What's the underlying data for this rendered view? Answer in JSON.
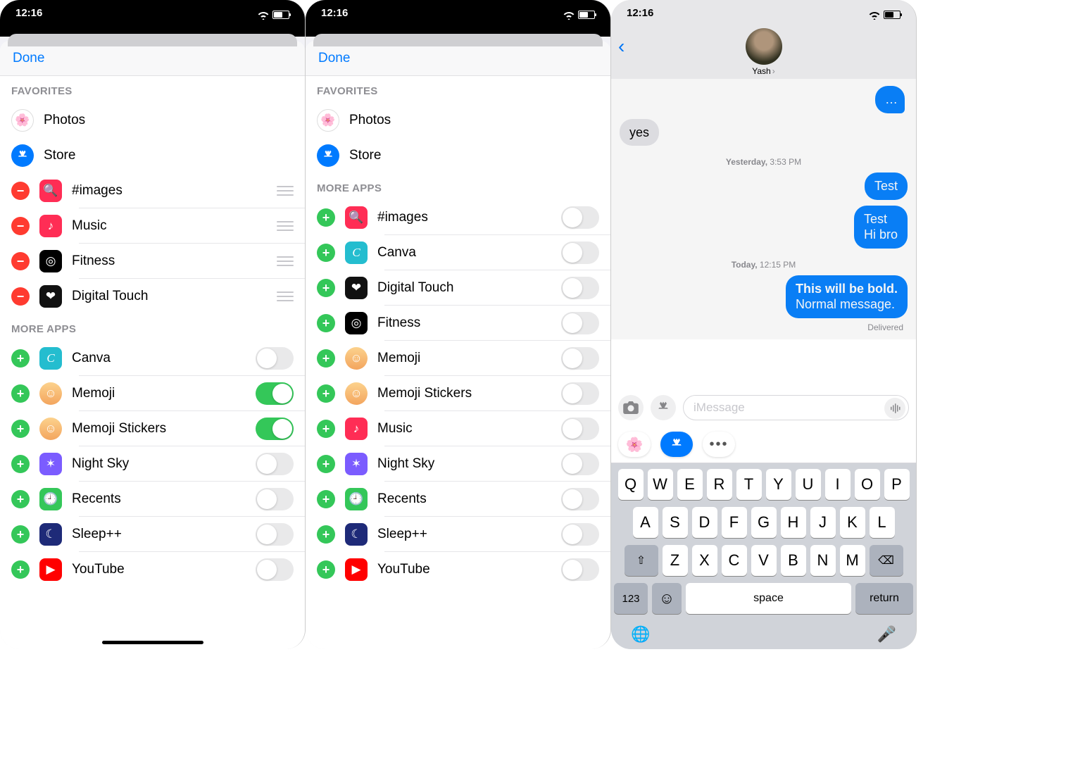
{
  "status_time": "12:16",
  "done_label": "Done",
  "section_favorites": "FAVORITES",
  "section_more_apps": "MORE APPS",
  "phone1": {
    "favorites_fixed": [
      {
        "label": "Photos",
        "icon": "photos"
      },
      {
        "label": "Store",
        "icon": "store"
      }
    ],
    "favorites_editable": [
      {
        "label": "#images",
        "icon": "images"
      },
      {
        "label": "Music",
        "icon": "music"
      },
      {
        "label": "Fitness",
        "icon": "fitness"
      },
      {
        "label": "Digital Touch",
        "icon": "digitaltouch"
      }
    ],
    "more_apps": [
      {
        "label": "Canva",
        "toggle": false
      },
      {
        "label": "Memoji",
        "toggle": true
      },
      {
        "label": "Memoji Stickers",
        "toggle": true
      },
      {
        "label": "Night Sky",
        "toggle": false
      },
      {
        "label": "Recents",
        "toggle": false
      },
      {
        "label": "Sleep++",
        "toggle": false
      },
      {
        "label": "YouTube",
        "toggle": false
      }
    ]
  },
  "phone2": {
    "favorites_fixed": [
      {
        "label": "Photos"
      },
      {
        "label": "Store"
      }
    ],
    "more_apps": [
      {
        "label": "#images"
      },
      {
        "label": "Canva"
      },
      {
        "label": "Digital Touch"
      },
      {
        "label": "Fitness"
      },
      {
        "label": "Memoji"
      },
      {
        "label": "Memoji Stickers"
      },
      {
        "label": "Music"
      },
      {
        "label": "Night Sky"
      },
      {
        "label": "Recents"
      },
      {
        "label": "Sleep++"
      },
      {
        "label": "YouTube"
      }
    ]
  },
  "phone3": {
    "contact": "Yash",
    "timestamps": {
      "t1_label": "Yesterday,",
      "t1_time": "3:53 PM",
      "t2_label": "Today,",
      "t2_time": "12:15 PM"
    },
    "messages": {
      "in1": "yes",
      "out1": "Test",
      "out2_line1": "Test",
      "out2_line2": "Hi bro",
      "out3_line1": "This will be bold.",
      "out3_line2": "Normal message."
    },
    "delivered_label": "Delivered",
    "compose_placeholder": "iMessage",
    "keyboard": {
      "row1": [
        "Q",
        "W",
        "E",
        "R",
        "T",
        "Y",
        "U",
        "I",
        "O",
        "P"
      ],
      "row2": [
        "A",
        "S",
        "D",
        "F",
        "G",
        "H",
        "J",
        "K",
        "L"
      ],
      "row3": [
        "Z",
        "X",
        "C",
        "V",
        "B",
        "N",
        "M"
      ],
      "numkey": "123",
      "space": "space",
      "return": "return"
    }
  }
}
